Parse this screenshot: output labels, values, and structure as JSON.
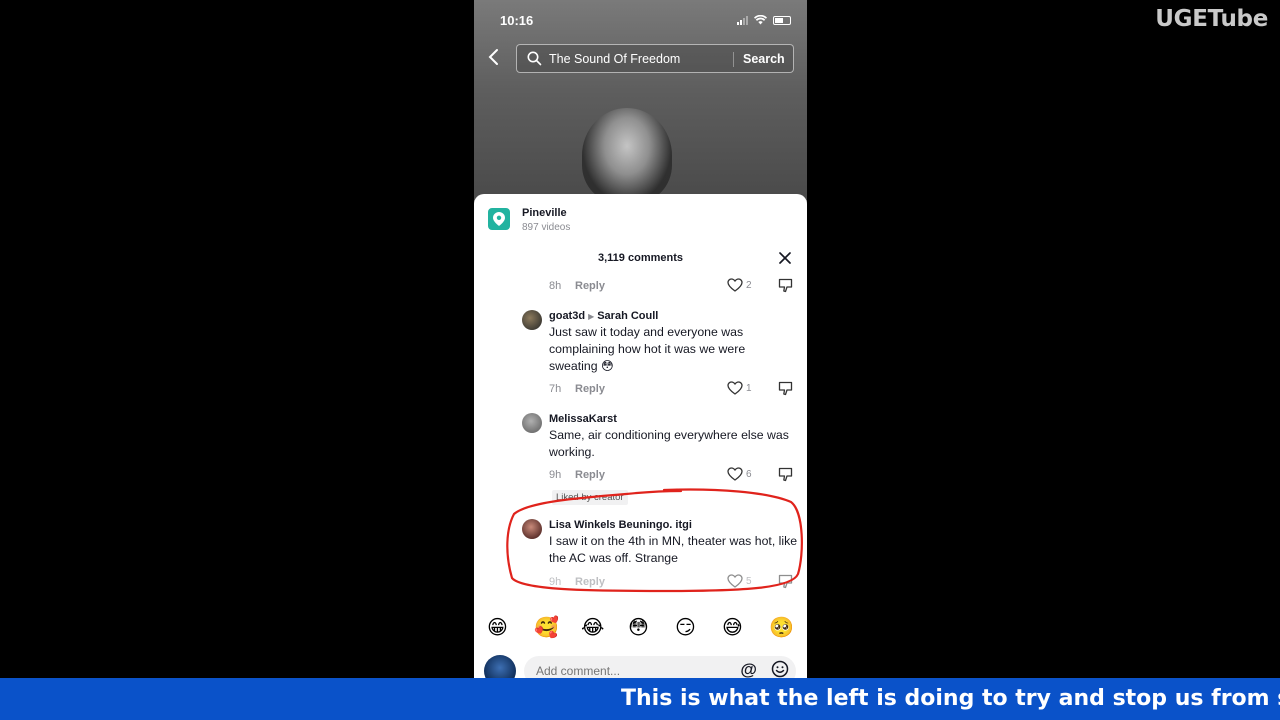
{
  "watermark": "UGETube",
  "status": {
    "time": "10:16"
  },
  "search": {
    "query": "The Sound Of Freedom",
    "button": "Search"
  },
  "place": {
    "name": "Pineville",
    "count": "897 videos"
  },
  "comments_header": "3,119 comments",
  "comments": [
    {
      "time": "8h",
      "reply": "Reply",
      "likes": "2"
    },
    {
      "user": "goat3d",
      "reply_to": "Sarah Coull",
      "text": "Just saw it today and everyone was complaining how hot it was we were sweating 😳",
      "time": "7h",
      "reply": "Reply",
      "likes": "1"
    },
    {
      "user": "MelissaKarst",
      "text": "Same, air conditioning everywhere else was working.",
      "time": "9h",
      "reply": "Reply",
      "likes": "6"
    },
    {
      "badge": "Liked by creator",
      "user": "Lisa Winkels Beuningo. itgi",
      "text": "I saw it on the 4th in MN, theater was hot, like the AC was off. Strange",
      "time": "9h",
      "reply": "Reply",
      "likes": "5"
    }
  ],
  "emojis": [
    "😁",
    "🥰",
    "😂",
    "😳",
    "😏",
    "😅",
    "🥺"
  ],
  "input": {
    "placeholder": "Add comment..."
  },
  "ticker": "This is what the left is doing to try and stop us from seeing"
}
